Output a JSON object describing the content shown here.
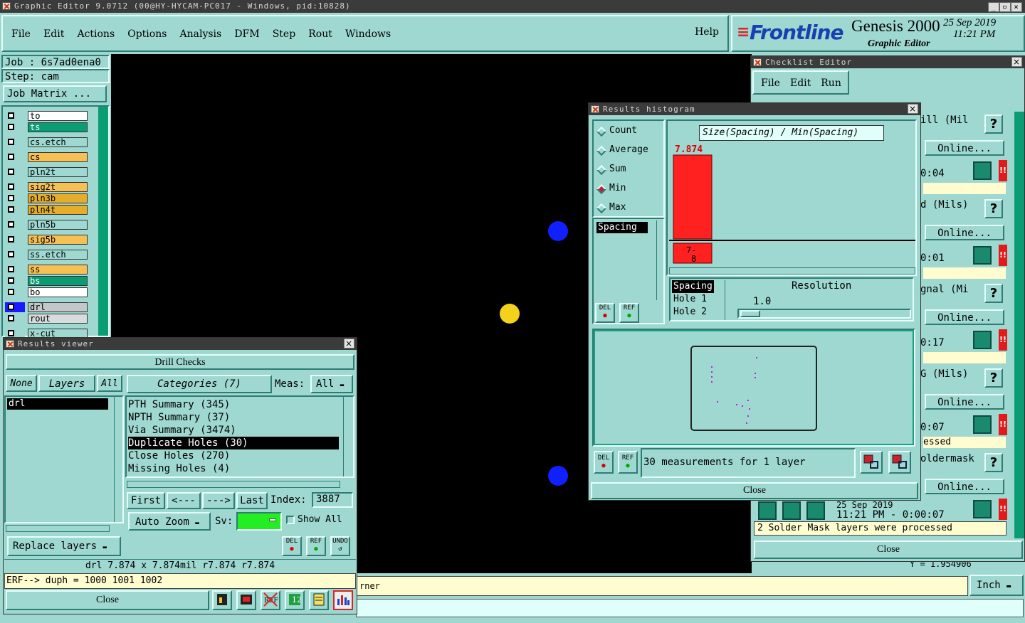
{
  "window": {
    "title": "Graphic Editor 9.0712 (00@HY-HYCAM-PC017 - Windows, pid:10828)"
  },
  "menu": [
    "File",
    "Edit",
    "Actions",
    "Options",
    "Analysis",
    "DFM",
    "Step",
    "Rout",
    "Windows"
  ],
  "help": "Help",
  "brand": {
    "logo": "Frontline",
    "product": "Genesis 2000",
    "subtitle": "Graphic Editor",
    "date": "25 Sep 2019",
    "time": "11:21 PM"
  },
  "job": {
    "job_label": "Job : 6s7ad0ena0",
    "step_label": "Step: cam",
    "matrix_button": "Job Matrix ..."
  },
  "layers": [
    {
      "name": "to",
      "color": "#ffffff"
    },
    {
      "name": "ts",
      "color": "#0a9d74"
    },
    {
      "name": "cs.etch",
      "color": "#9ed8d0"
    },
    {
      "name": "cs",
      "color": "#f6c054"
    },
    {
      "name": "pln2t",
      "color": "#9ed8d0"
    },
    {
      "name": "sig2t",
      "color": "#f6c054"
    },
    {
      "name": "pln3b",
      "color": "#e6ad2a"
    },
    {
      "name": "pln4t",
      "color": "#e6ad2a"
    },
    {
      "name": "pln5b",
      "color": "#9ed8d0"
    },
    {
      "name": "sig5b",
      "color": "#f6c054"
    },
    {
      "name": "ss.etch",
      "color": "#9ed8d0"
    },
    {
      "name": "ss",
      "color": "#f6c054"
    },
    {
      "name": "bs",
      "color": "#0a9d74"
    },
    {
      "name": "bo",
      "color": "#ffffff"
    },
    {
      "name": "drl",
      "color": "#c0c8c8"
    },
    {
      "name": "rout",
      "color": "#d8dcdc"
    },
    {
      "name": "x-cut",
      "color": "#9ed8d0"
    }
  ],
  "results_viewer": {
    "title": "Results viewer",
    "header": "Drill Checks",
    "none": "None",
    "layers_btn": "Layers",
    "all": "All",
    "categories_btn": "Categories (7)",
    "meas_label": "Meas:",
    "meas_value": "All",
    "layer_list": [
      "drl"
    ],
    "categories": [
      "PTH Summary (345)",
      "NPTH Summary (37)",
      "Via Summary (3474)",
      "Duplicate Holes (30)",
      "Close Holes (270)",
      "Missing Holes (4)"
    ],
    "first": "First",
    "prev": "<---",
    "next": "--->",
    "last": "Last",
    "index_label": "Index:",
    "index_value": "3887",
    "auto_zoom": "Auto Zoom",
    "sv_label": "Sv:",
    "show_all": "Show All",
    "replace_layers": "Replace layers",
    "del": "DEL",
    "ref": "REF",
    "undo": "UNDO",
    "info_line": "drl 7.874 x 7.874mil  r7.874  r7.874",
    "erf_line": "ERF--> duph = 1000 1001 1002",
    "close": "Close"
  },
  "histogram": {
    "title": "Results histogram",
    "radios": [
      "Count",
      "Average",
      "Sum",
      "Min",
      "Max"
    ],
    "selected": "Min",
    "plot_title": "Size(Spacing) / Min(Spacing)",
    "list": [
      "Spacing"
    ],
    "res_list": [
      "Spacing",
      "Hole 1",
      "Hole 2"
    ],
    "resolution_label": "Resolution",
    "resolution_value": "1.0",
    "del": "DEL",
    "ref": "REF",
    "measurements": "30 measurements for 1 layer",
    "close": "Close"
  },
  "chart_data": {
    "type": "bar",
    "title": "Size(Spacing) / Min(Spacing)",
    "categories": [
      "7-8"
    ],
    "values": [
      7.874
    ],
    "bar_labels": [
      "7.874"
    ],
    "color": "#ff2020"
  },
  "checklist": {
    "title": "Checklist Editor",
    "menu": [
      "File",
      "Edit",
      "Run"
    ],
    "rows": [
      {
        "name": "ill (Mil",
        "online": "Online...",
        "time": "0:04"
      },
      {
        "name": "d (Mils)",
        "online": "Online...",
        "time": "0:01"
      },
      {
        "name": "gnal (Mi",
        "online": "Online...",
        "time": "0:17"
      },
      {
        "name": "G (Mils)",
        "online": "Online...",
        "time": "0:07",
        "status": "essed"
      },
      {
        "name": "oldermask",
        "online": "Online...",
        "date": "25 Sep 2019",
        "time": "11:21 PM - 0:00:07"
      }
    ],
    "message": "2 Solder Mask layers were processed",
    "close": "Close",
    "qmark": "?",
    "excl": "!!"
  },
  "status": {
    "text": "rner",
    "unit": "Inch",
    "coord": "Y = 1.954906"
  }
}
